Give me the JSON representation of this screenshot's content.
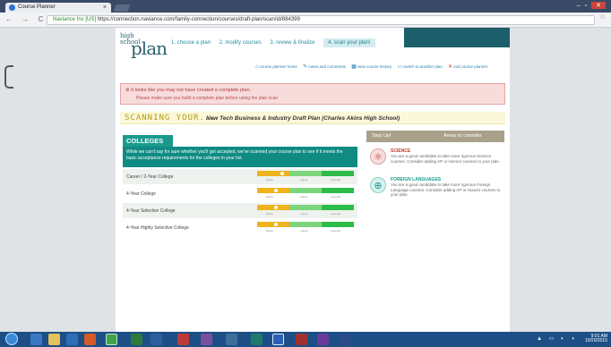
{
  "browser": {
    "tab_title": "Course Planner",
    "tab_close": "×",
    "nav_icons": "← → C",
    "lock_label": "Naviance Inc [US]",
    "url": "https://connection.naviance.com/family-connection/courses/draft-plan/scan/id/884399",
    "star": "☆"
  },
  "app": {
    "logo_small": "high school",
    "logo_big": "plan",
    "steps": [
      "1. choose a plan",
      "2. modify courses",
      "3. review & finalize",
      "4. scan your plan!"
    ],
    "links": [
      {
        "icon": "⌂",
        "label": "course planner home"
      },
      {
        "icon": "✎",
        "label": "notes and comments"
      },
      {
        "icon": "▦",
        "label": "view course history"
      },
      {
        "icon": "▭",
        "label": "switch to another plan"
      },
      {
        "icon": "✕",
        "label": "exit course planner"
      }
    ]
  },
  "alert": {
    "title": "⊗ It looks like you may not have created a complete plan.",
    "message": "Please make sure you build a complete plan before using the plan scan"
  },
  "scanning": {
    "label": "SCANNING YOUR...",
    "plan_name": "New Tech Business & Industry Draft Plan (Charles Akins High School)"
  },
  "colleges": {
    "title": "COLLEGES",
    "intro": "While we can't say for sure whether you'll get accepted, we've scanned your course plan to see if it meets the basic acceptance requirements for the colleges in your list.",
    "scale_labels": [
      "below",
      "meets",
      "exceeds"
    ],
    "rows": [
      {
        "name": "Career / 2-Year College",
        "level": 0.24
      },
      {
        "name": "4-Year College",
        "level": 0.18
      },
      {
        "name": "4-Year Selective College",
        "level": 0.18
      },
      {
        "name": "4-Year Highly Selective College",
        "level": 0.18
      }
    ]
  },
  "side": {
    "col_a": "Step Up!",
    "col_b": "Areas to consider",
    "items": [
      {
        "icon": "⚛",
        "title": "SCIENCE",
        "desc": "You are a good candidate to take more rigorous Science courses. Consider adding AP or Honors courses to your plan."
      },
      {
        "icon": "⊕",
        "title": "FOREIGN LANGUAGES",
        "desc": "You are a good candidate to take more rigorous Foreign Language courses. Consider adding AP or Honors courses to your plan."
      }
    ]
  },
  "taskbar": {
    "time": "9:01 AM",
    "date": "10/20/2015",
    "tray": "▲ ▭ ◐ ◑"
  },
  "colors": {
    "teal": "#1a9a8c",
    "alert_red": "#b13a3a",
    "gold": "#b89a14"
  }
}
